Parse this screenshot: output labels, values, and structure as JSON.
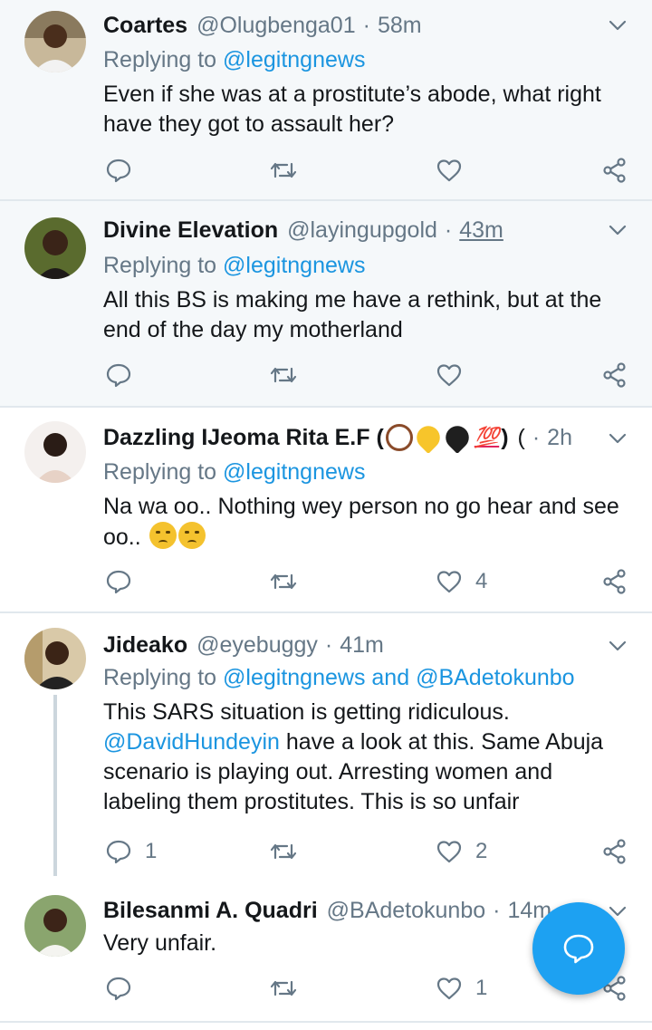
{
  "tweets": [
    {
      "name": "Coartes",
      "handle": "@Olugbenga01",
      "sep": "·",
      "time": "58m",
      "replying_prefix": "Replying to",
      "replying_to": "@legitngnews",
      "text": "Even if she was at a prostitute’s abode, what right have they got to assault her?",
      "reply_count": "",
      "like_count": ""
    },
    {
      "name": "Divine Elevation",
      "handle": "@layingupgold",
      "sep": "·",
      "time": "43m",
      "replying_prefix": "Replying to",
      "replying_to": "@legitngnews",
      "text": "All this BS is making me have a rethink, but at the end of the day my motherland",
      "reply_count": "",
      "like_count": ""
    },
    {
      "name": "Dazzling IJeoma Rita E.F (",
      "name_emoji_100": "💯",
      "name_close": ")",
      "handle_clipped": "(",
      "sep": "·",
      "time": "2h",
      "replying_prefix": "Replying to",
      "replying_to": "@legitngnews",
      "text": "Na wa oo.. Nothing wey person no go hear and see oo..",
      "reply_count": "",
      "like_count": "4"
    },
    {
      "name": "Jideako",
      "handle": "@eyebuggy",
      "sep": "·",
      "time": "41m",
      "replying_prefix": "Replying to",
      "replying_to": "@legitngnews",
      "replying_and": "and",
      "replying_to_2": "@BAdetokunbo",
      "text_line1": "This SARS situation is getting ridiculous.",
      "mention": "@DavidHundeyin",
      "text_rest": " have a look at this. Same Abuja scenario is playing out. Arresting women and labeling them prostitutes. This is so unfair",
      "reply_count": "1",
      "like_count": "2"
    },
    {
      "name": "Bilesanmi A. Quadri",
      "handle": "@BAdetokunbo",
      "sep": "·",
      "time": "14m",
      "text": "Very unfair.",
      "reply_count": "",
      "like_count": "1"
    }
  ],
  "colors": {
    "link": "#1b95e0",
    "muted": "#657786",
    "fab": "#1da1f2",
    "shaded_bg": "#f5f8fa"
  },
  "icons": [
    "reply-icon",
    "retweet-icon",
    "like-icon",
    "share-icon",
    "chevron-down-icon",
    "compose-reply-icon"
  ]
}
